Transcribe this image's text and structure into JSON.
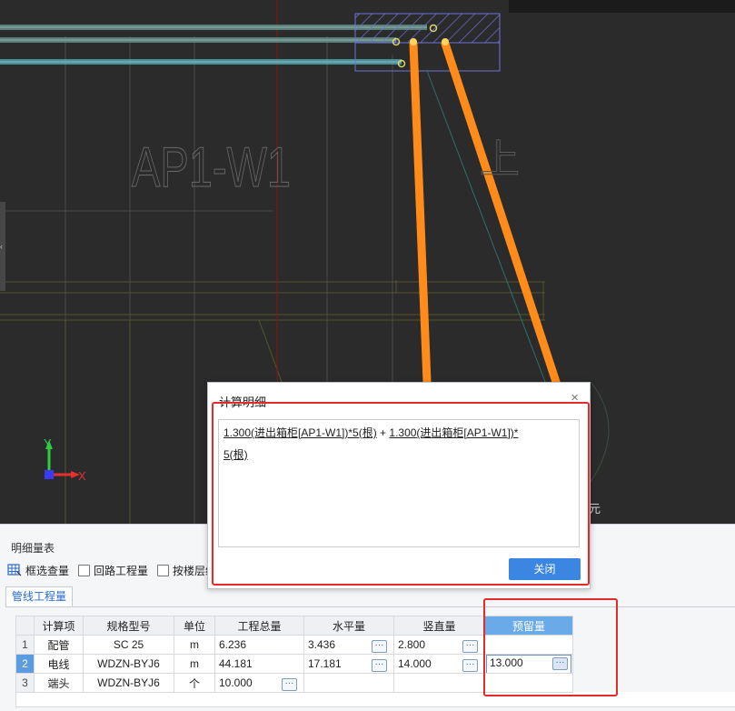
{
  "viewport": {
    "drawing_label": "AP1-W1",
    "side_char": "上",
    "edge_char": "元",
    "axis_y": "Y",
    "axis_x": "X"
  },
  "panel": {
    "title": "明细量表",
    "toolbar": {
      "box_select": "框选查量",
      "loop_qty": "回路工程量",
      "by_floor": "按楼层统"
    },
    "tab": "管线工程量"
  },
  "table": {
    "headers": [
      "",
      "计算项",
      "规格型号",
      "单位",
      "工程总量",
      "水平量",
      "竖直量",
      "预留量"
    ],
    "rows": [
      {
        "num": "1",
        "item": "配管",
        "spec": "SC 25",
        "unit": "m",
        "total": "6.236",
        "horizontal": "3.436",
        "vertical": "2.800",
        "reserve": ""
      },
      {
        "num": "2",
        "item": "电线",
        "spec": "WDZN-BYJ6",
        "unit": "m",
        "total": "44.181",
        "horizontal": "17.181",
        "vertical": "14.000",
        "reserve": "13.000"
      },
      {
        "num": "3",
        "item": "端头",
        "spec": "WDZN-BYJ6",
        "unit": "个",
        "total": "10.000",
        "horizontal": "",
        "vertical": "",
        "reserve": ""
      }
    ],
    "ellipsis": "···"
  },
  "modal": {
    "title": "计算明细",
    "close_x": "×",
    "formula_part1": "1.300(进出箱柜[AP1-W1])*5(根)",
    "plus": " + ",
    "formula_part2a": "1.300(进出箱柜[AP1-W1])*",
    "formula_part2b": "5(根)",
    "close_button": "关闭"
  },
  "colors": {
    "cad_background": "#2b2b2b",
    "wire_orange": "#ff8c1a",
    "highlight_red": "#e52a2a",
    "button_blue": "#3b86e0",
    "selected_header": "#6aaae8"
  }
}
